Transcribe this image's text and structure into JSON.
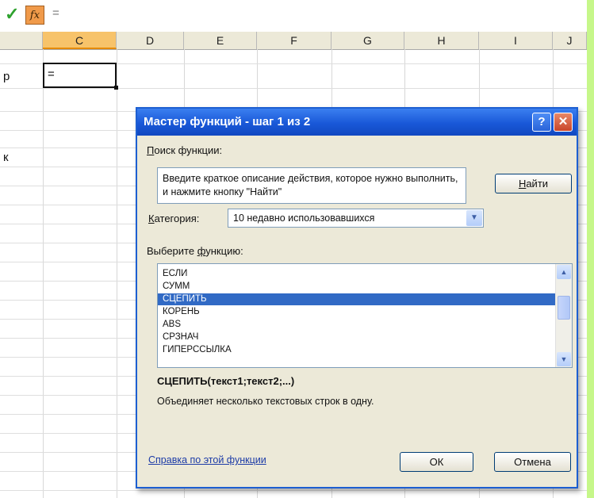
{
  "formula_bar": {
    "check_glyph": "✓",
    "fx_label": "fx",
    "content": "="
  },
  "columns": [
    "C",
    "D",
    "E",
    "F",
    "G",
    "H",
    "I",
    "J"
  ],
  "active_column": "C",
  "row_fragments": {
    "row1": "р",
    "row2": "к"
  },
  "active_cell": {
    "value": "="
  },
  "dialog": {
    "title": "Мастер функций - шаг 1 из 2",
    "help_button": "?",
    "close_button": "✕",
    "search_label": "Поиск функции:",
    "search_label_mnemonic": "П",
    "search_label_rest": "оиск функции:",
    "search_text": "Введите краткое описание действия, которое нужно выполнить, и нажмите кнопку \"Найти\"",
    "find_button": "Найти",
    "find_button_mnemonic": "Н",
    "find_button_rest": "айти",
    "category_label_mnemonic": "К",
    "category_label_rest": "атегория:",
    "category_value": "10 недавно использовавшихся",
    "functions_label_start": "Выберите ",
    "functions_label_mnemonic": "ф",
    "functions_label_rest": "ункцию:",
    "functions": [
      "ЕСЛИ",
      "СУММ",
      "СЦЕПИТЬ",
      "КОРЕНЬ",
      "ABS",
      "СРЗНАЧ",
      "ГИПЕРССЫЛКА"
    ],
    "selected_function": "СЦЕПИТЬ",
    "signature": "СЦЕПИТЬ(текст1;текст2;...)",
    "description": "Объединяет несколько текстовых строк в одну.",
    "help_link": "Справка по этой функции",
    "ok_button": "ОК",
    "cancel_button": "Отмена"
  },
  "colors": {
    "background": "#c6f78a",
    "titlebar": "#1958d8",
    "selection": "#316ac5",
    "link": "#1c3ba7"
  }
}
